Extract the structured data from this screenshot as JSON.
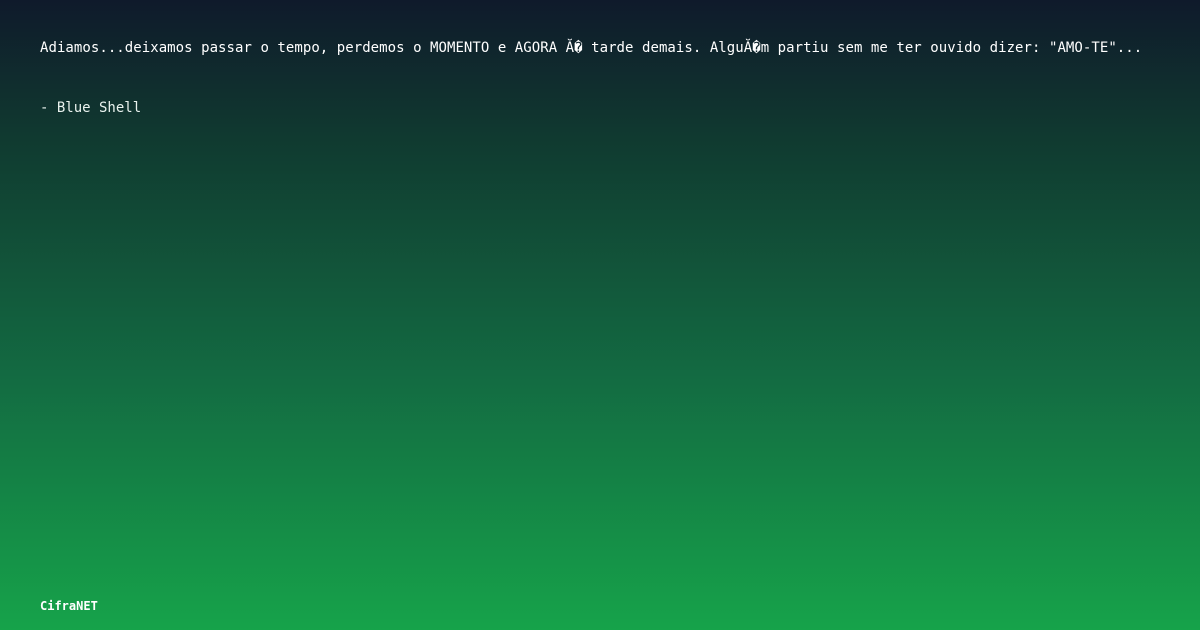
{
  "quote": {
    "text": "Adiamos...deixamos passar o tempo, perdemos o MOMENTO e AGORA Ă� tarde demais. AlguĂ�m partiu sem me ter ouvido dizer: \"AMO-TE\"..."
  },
  "author": {
    "text": "- Blue Shell"
  },
  "brand": {
    "name": "CifraNET"
  }
}
